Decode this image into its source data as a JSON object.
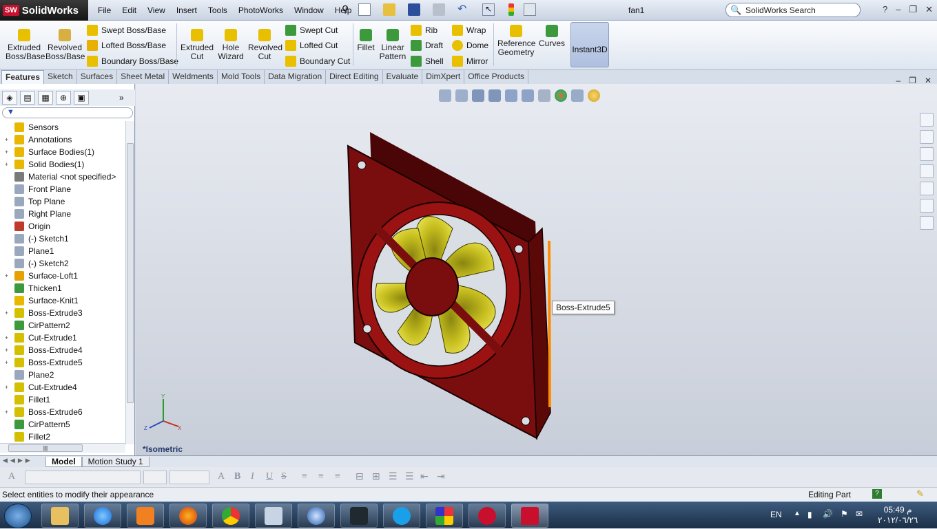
{
  "app": {
    "brand": "SolidWorks",
    "document": "fan1"
  },
  "menu": [
    "File",
    "Edit",
    "View",
    "Insert",
    "Tools",
    "PhotoWorks",
    "Window",
    "Help"
  ],
  "search": {
    "placeholder": "SolidWorks Search"
  },
  "ribbon": {
    "extruded_boss": "Extruded Boss/Base",
    "revolved_boss": "Revolved Boss/Base",
    "swept_boss": "Swept Boss/Base",
    "lofted_boss": "Lofted Boss/Base",
    "boundary_boss": "Boundary Boss/Base",
    "extruded_cut": "Extruded Cut",
    "hole_wizard": "Hole Wizard",
    "revolved_cut": "Revolved Cut",
    "swept_cut": "Swept Cut",
    "lofted_cut": "Lofted Cut",
    "boundary_cut": "Boundary Cut",
    "fillet": "Fillet",
    "linear_pattern": "Linear Pattern",
    "rib": "Rib",
    "draft": "Draft",
    "shell": "Shell",
    "wrap": "Wrap",
    "dome": "Dome",
    "mirror": "Mirror",
    "reference_geometry": "Reference Geometry",
    "curves": "Curves",
    "instant3d": "Instant3D"
  },
  "tabs": [
    "Features",
    "Sketch",
    "Surfaces",
    "Sheet Metal",
    "Weldments",
    "Mold Tools",
    "Data Migration",
    "Direct Editing",
    "Evaluate",
    "DimXpert",
    "Office Products"
  ],
  "tree": [
    {
      "label": "Sensors",
      "expand": false,
      "color": "#e8b800"
    },
    {
      "label": "Annotations",
      "expand": true,
      "color": "#e8b800"
    },
    {
      "label": "Surface Bodies(1)",
      "expand": true,
      "color": "#e8b800"
    },
    {
      "label": "Solid Bodies(1)",
      "expand": true,
      "color": "#e8b800"
    },
    {
      "label": "Material <not specified>",
      "expand": false,
      "color": "#7a7a7a"
    },
    {
      "label": "Front Plane",
      "expand": false,
      "color": "#9aa8bd"
    },
    {
      "label": "Top Plane",
      "expand": false,
      "color": "#9aa8bd"
    },
    {
      "label": "Right Plane",
      "expand": false,
      "color": "#9aa8bd"
    },
    {
      "label": "Origin",
      "expand": false,
      "color": "#c0392b"
    },
    {
      "label": "(-) Sketch1",
      "expand": false,
      "color": "#9aa8bd"
    },
    {
      "label": "Plane1",
      "expand": false,
      "color": "#9aa8bd"
    },
    {
      "label": "(-) Sketch2",
      "expand": false,
      "color": "#9aa8bd"
    },
    {
      "label": "Surface-Loft1",
      "expand": true,
      "color": "#e8a000"
    },
    {
      "label": "Thicken1",
      "expand": false,
      "color": "#3c9a3c"
    },
    {
      "label": "Surface-Knit1",
      "expand": false,
      "color": "#e8b800"
    },
    {
      "label": "Boss-Extrude3",
      "expand": true,
      "color": "#d4c000"
    },
    {
      "label": "CirPattern2",
      "expand": false,
      "color": "#3c9a3c"
    },
    {
      "label": "Cut-Extrude1",
      "expand": true,
      "color": "#d4c000"
    },
    {
      "label": "Boss-Extrude4",
      "expand": true,
      "color": "#d4c000"
    },
    {
      "label": "Boss-Extrude5",
      "expand": true,
      "color": "#d4c000"
    },
    {
      "label": "Plane2",
      "expand": false,
      "color": "#9aa8bd"
    },
    {
      "label": "Cut-Extrude4",
      "expand": true,
      "color": "#d4c000"
    },
    {
      "label": "Fillet1",
      "expand": false,
      "color": "#d4c000"
    },
    {
      "label": "Boss-Extrude6",
      "expand": true,
      "color": "#d4c000"
    },
    {
      "label": "CirPattern5",
      "expand": false,
      "color": "#3c9a3c"
    },
    {
      "label": "Fillet2",
      "expand": false,
      "color": "#d4c000"
    }
  ],
  "viewport": {
    "tooltip": "Boss-Extrude5",
    "view_label": "*Isometric",
    "model_color": "#7a0e0e",
    "blade_color": "#c8c020"
  },
  "bottom_tabs": [
    "Model",
    "Motion Study 1"
  ],
  "status": {
    "left": "Select entities to modify their appearance",
    "right": "Editing Part"
  },
  "tray": {
    "lang": "EN",
    "time": "05:49 م",
    "date": "٢٠١٢/٠٦/٢٦"
  }
}
